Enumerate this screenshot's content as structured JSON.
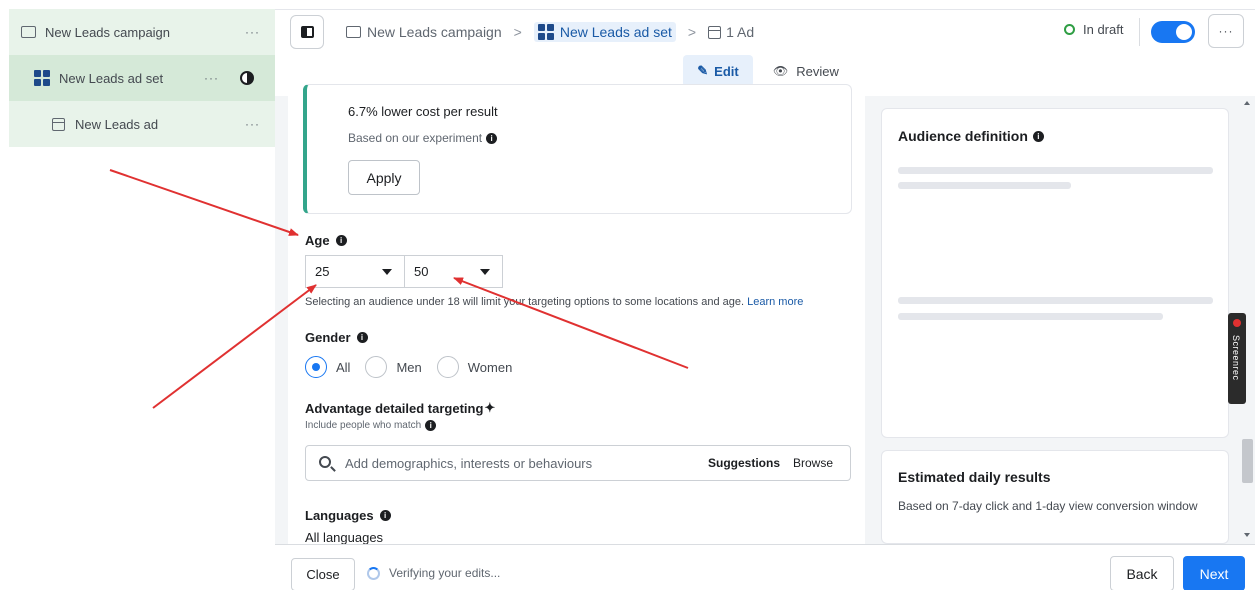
{
  "tree": {
    "campaign": {
      "label": "New Leads campaign",
      "more": "···"
    },
    "adset": {
      "label": "New Leads ad set",
      "more": "···"
    },
    "ad": {
      "label": "New Leads ad",
      "more": "···"
    }
  },
  "breadcrumb": {
    "campaign": "New Leads campaign",
    "adset": "New Leads ad set",
    "ad": "1 Ad",
    "separator": ">"
  },
  "header": {
    "status": "In draft",
    "more": "···",
    "status_color": "#2f9e44"
  },
  "tabs": {
    "edit": "Edit",
    "review": "Review"
  },
  "recommendation": {
    "title": "6.7% lower cost per result",
    "subtitle": "Based on our experiment",
    "apply": "Apply"
  },
  "age": {
    "label": "Age",
    "min": "25",
    "max": "50",
    "note": "Selecting an audience under 18 will limit your targeting options to some locations and age.",
    "learn_more": "Learn more"
  },
  "gender": {
    "label": "Gender",
    "options": [
      "All",
      "Men",
      "Women"
    ],
    "selected": "All"
  },
  "targeting": {
    "title": "Advantage detailed targeting",
    "sparkle": "✦",
    "include": "Include people who match",
    "placeholder": "Add demographics, interests or behaviours",
    "suggestions": "Suggestions",
    "browse": "Browse"
  },
  "languages": {
    "label": "Languages",
    "value": "All languages"
  },
  "audience_card": {
    "title": "Audience definition"
  },
  "results_card": {
    "title": "Estimated daily results",
    "description": "Based on 7-day click and 1-day view conversion window"
  },
  "footer": {
    "close": "Close",
    "verifying": "Verifying your edits...",
    "back": "Back",
    "next": "Next"
  },
  "overlay": {
    "screenrec": "Screenrec"
  },
  "colors": {
    "accent": "#1877f2",
    "tree_bg": "#e8f3ea",
    "annotation_arrows": "#e03131"
  }
}
